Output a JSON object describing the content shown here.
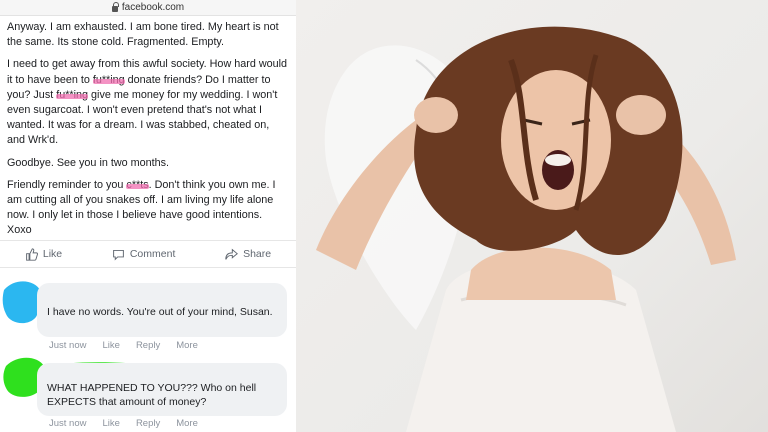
{
  "browser": {
    "url": "facebook.com"
  },
  "post": {
    "paragraphs": [
      "Anyway. I am exhausted. I am bone tired. My heart is not the same. Its stone cold. Fragmented. Empty.",
      [
        "I need to get away from this awful society. How hard would it to have been to ",
        "fu**ing",
        " donate friends? Do I matter to you? Just ",
        "fu**ing",
        " give me money for my wedding. I won't even sugarcoat. I won't even pretend that's not what I wanted. It was for a dream. I was stabbed, cheated on, and Wrk'd."
      ],
      "Goodbye. See you in two months.",
      [
        "Friendly reminder to you ",
        "c**ts",
        ". Don't think you own me. I am cutting all of you snakes off. I am living my life alone now. I only let in those I believe have good intentions. Xoxo"
      ]
    ]
  },
  "actions": {
    "like": "Like",
    "comment": "Comment",
    "share": "Share"
  },
  "comments": [
    {
      "text": "I have no words. You're out of your mind, Susan.",
      "time": "Just now",
      "like": "Like",
      "reply": "Reply",
      "more": "More",
      "scribble_color": "#2bb7f0"
    },
    {
      "text": "WHAT HAPPENED TO YOU??? Who on hell EXPECTS that amount of money?",
      "time": "Just now",
      "like": "Like",
      "reply": "Reply",
      "more": "More",
      "scribble_color": "#2fe01e"
    }
  ],
  "colors": {
    "censor": "#f06fb0",
    "link_gray": "#8d949e"
  }
}
